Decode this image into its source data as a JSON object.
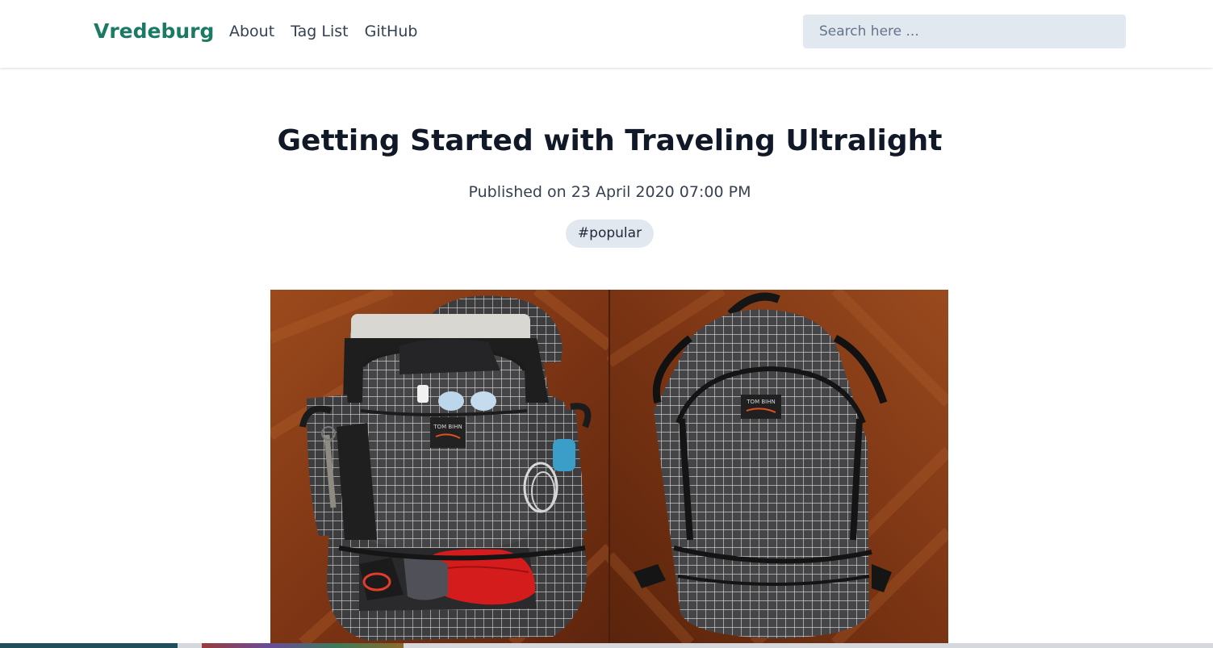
{
  "header": {
    "brand": "Vredeburg",
    "nav": [
      {
        "label": "About"
      },
      {
        "label": "Tag List"
      },
      {
        "label": "GitHub"
      }
    ],
    "search": {
      "placeholder": "Search here ...",
      "value": ""
    }
  },
  "post": {
    "title": "Getting Started with Traveling Ultralight",
    "published": "Published on 23 April 2020 07:00 PM",
    "tags": [
      "#popular"
    ],
    "hero_image": {
      "left_label": "TOM BIHN",
      "right_label": "TOM BIHN"
    }
  },
  "colors": {
    "brand": "#1b7a66",
    "search_bg": "#e2e8f0",
    "tag_bg": "#e2e8f0",
    "wood": "#8a4420"
  }
}
